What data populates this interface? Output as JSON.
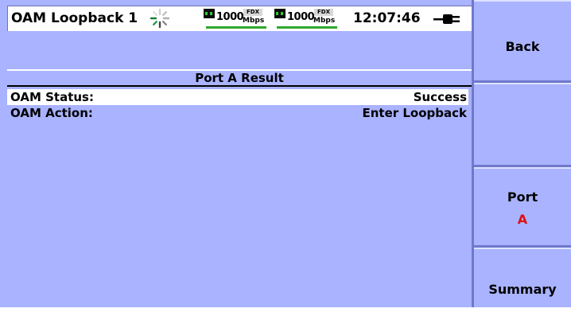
{
  "header": {
    "title": "OAM Loopback 1",
    "busy_icon": "spinner-icon",
    "links": [
      {
        "speed": "1000",
        "duplex": "FDX",
        "unit": "Mbps",
        "status_color": "#2fa82f"
      },
      {
        "speed": "1000",
        "duplex": "FDX",
        "unit": "Mbps",
        "status_color": "#2fa82f"
      }
    ],
    "clock": "12:07:46",
    "power_icon": "ac-power-plug-icon"
  },
  "result": {
    "section_title": "Port A Result",
    "rows": [
      {
        "label": "OAM Status:",
        "value": "Success"
      },
      {
        "label": "OAM Action:",
        "value": "Enter Loopback"
      }
    ]
  },
  "softkeys": {
    "back": "Back",
    "blank": "",
    "port_label": "Port",
    "port_value": "A",
    "summary": "Summary"
  },
  "colors": {
    "background": "#a9b3ff",
    "panel_edge": "#6f78cc",
    "accent_value": "#e01010"
  }
}
